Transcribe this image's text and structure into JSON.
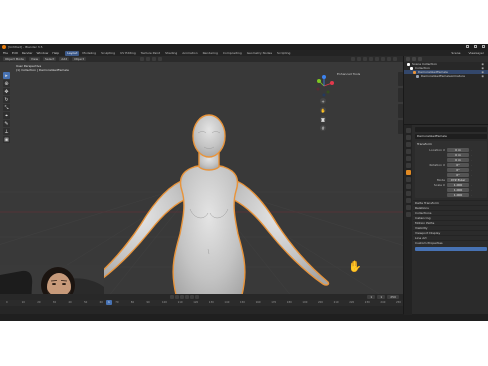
{
  "window": {
    "title": "[Untitled] - Blender 3.5"
  },
  "menus": [
    "File",
    "Edit",
    "Render",
    "Window",
    "Help"
  ],
  "workspace_tabs": [
    "Layout",
    "Modeling",
    "Sculpting",
    "UV Editing",
    "Texture Paint",
    "Shading",
    "Animation",
    "Rendering",
    "Compositing",
    "Geometry Nodes",
    "Scripting"
  ],
  "active_tab": "Layout",
  "scene": {
    "scene_label": "Scene",
    "view_layer_label": "ViewLayer"
  },
  "viewport": {
    "mode": "Object Mode",
    "menu_items": [
      "View",
      "Select",
      "Add",
      "Object"
    ],
    "transform": "Global",
    "info_line1": "User Perspective",
    "info_line2": "(1) Collection | DemoralizedFemale",
    "top_right_label": "Enhanced Tools",
    "gizmo_axes": {
      "x_color": "#e2394c",
      "y_color": "#7ec722",
      "z_color": "#3d84f0"
    },
    "selection_outline": "#e8943b"
  },
  "outliner": {
    "rows": [
      {
        "label": "Scene Collection",
        "selected": false,
        "color": "#ffffff"
      },
      {
        "label": "Collection",
        "selected": false,
        "color": "#ffffff"
      },
      {
        "label": "DemoralizedFemale",
        "selected": true,
        "color": "#e8943b"
      },
      {
        "label": "DemoralizedFemaleArmature",
        "selected": false,
        "color": "#9aa5b5"
      }
    ]
  },
  "properties": {
    "object_name": "DemoralizedFemale",
    "transform_header": "Transform",
    "location_label": "Location X",
    "location": [
      "0 m",
      "0 m",
      "0 m"
    ],
    "rotation_label": "Rotation X",
    "rotation": [
      "0°",
      "0°",
      "0°"
    ],
    "mode_label": "Mode",
    "mode_value": "XYZ Euler",
    "scale_label": "Scale X",
    "scale": [
      "1.000",
      "1.000",
      "1.000"
    ],
    "collapsed_panels": [
      "Delta Transform",
      "Relations",
      "Collections",
      "Instancing",
      "Motion Paths",
      "Visibility",
      "Viewport Display",
      "Line Art",
      "Custom Properties"
    ]
  },
  "timeline": {
    "current_frame": "1",
    "start": "1",
    "end": "250",
    "ticks": [
      "0",
      "10",
      "20",
      "30",
      "40",
      "50",
      "60",
      "70",
      "80",
      "90",
      "100",
      "110",
      "120",
      "130",
      "140",
      "150",
      "160",
      "170",
      "180",
      "190",
      "200",
      "210",
      "220",
      "230",
      "240",
      "250"
    ]
  }
}
